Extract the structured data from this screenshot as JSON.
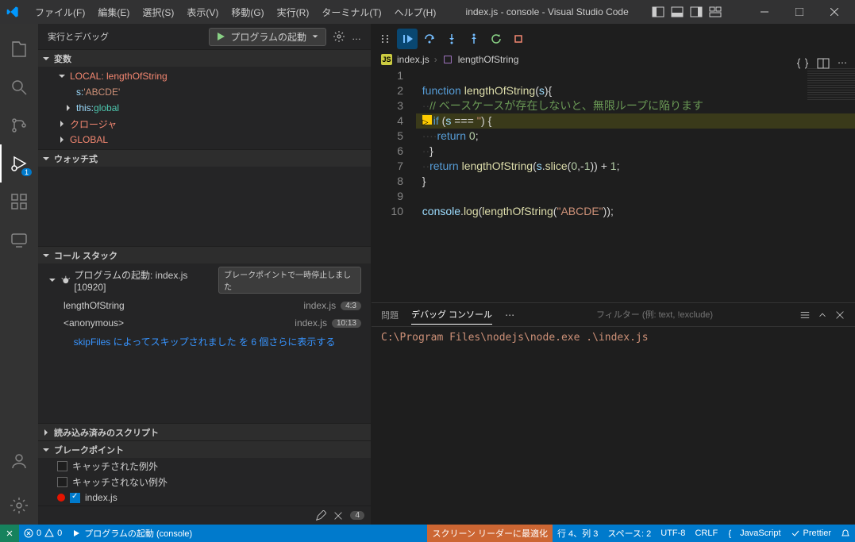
{
  "title": "index.js - console - Visual Studio Code",
  "menu": [
    "ファイル(F)",
    "編集(E)",
    "選択(S)",
    "表示(V)",
    "移動(G)",
    "実行(R)",
    "ターミナル(T)",
    "ヘルプ(H)"
  ],
  "activity_badge": "1",
  "sidebar": {
    "title": "実行とデバッグ",
    "launch_label": "プログラムの起動",
    "vars_header": "変数",
    "local_header": "LOCAL: lengthOfString",
    "var_s_key": "s: ",
    "var_s_val": "'ABCDE'",
    "var_this_key": "this: ",
    "var_this_val": "global",
    "closure_header": "クロージャ",
    "global_header": "GLOBAL",
    "watch_header": "ウォッチ式",
    "callstack_header": "コール スタック",
    "cs_program": "プログラムの起動: index.js [10920]",
    "cs_status": "ブレークポイントで一時停止しました",
    "frame1_name": "lengthOfString",
    "frame1_file": "index.js",
    "frame1_line": "4:3",
    "frame2_name": "<anonymous>",
    "frame2_file": "index.js",
    "frame2_line": "10:13",
    "skipfiles": "skipFiles によってスキップされました を 6 個さらに表示する",
    "loaded_scripts_header": "読み込み済みのスクリプト",
    "breakpoints_header": "ブレークポイント",
    "bp_caught": "キャッチされた例外",
    "bp_uncaught": "キャッチされない例外",
    "bp_file": "index.js",
    "bp_count": "4"
  },
  "breadcrumb": {
    "file": "index.js",
    "symbol": "lengthOfString"
  },
  "code": {
    "lines": [
      {
        "n": "1",
        "html": ""
      },
      {
        "n": "2",
        "html": "<span class='tok-kw'>function</span> <span class='tok-fn'>lengthOfString</span><span class='tok-pn'>(</span><span class='tok-var'>s</span><span class='tok-pn'>){</span>"
      },
      {
        "n": "3",
        "html": "<span class='tok-ws'>··</span><span class='tok-cm'>// ベースケースが存在しないと、無限ループに陥ります</span>"
      },
      {
        "n": "4",
        "html": "<span class='tok-ws'></span><span class='inline-ptr'>▷</span><span class='tok-kw'>if</span> <span class='tok-pn'>(</span><span class='tok-var'>s</span> <span class='tok-pn'>===</span> <span class='tok-str'>''</span><span class='tok-pn'>) {</span>",
        "hl": true,
        "bp": true
      },
      {
        "n": "5",
        "html": "<span class='tok-ws'>····</span><span class='tok-kw'>return</span> <span class='tok-num'>0</span><span class='tok-pn'>;</span>"
      },
      {
        "n": "6",
        "html": "<span class='tok-ws'>··</span><span class='tok-pn'>}</span>"
      },
      {
        "n": "7",
        "html": "<span class='tok-ws'>··</span><span class='tok-kw'>return</span> <span class='tok-fn'>lengthOfString</span><span class='tok-pn'>(</span><span class='tok-var'>s</span><span class='tok-pn'>.</span><span class='tok-fn'>slice</span><span class='tok-pn'>(</span><span class='tok-num'>0</span><span class='tok-pn'>,-</span><span class='tok-num'>1</span><span class='tok-pn'>)) + </span><span class='tok-num'>1</span><span class='tok-pn'>;</span>"
      },
      {
        "n": "8",
        "html": "<span class='tok-pn'>}</span>"
      },
      {
        "n": "9",
        "html": ""
      },
      {
        "n": "10",
        "html": "<span class='tok-var'>console</span><span class='tok-pn'>.</span><span class='tok-fn'>log</span><span class='tok-pn'>(</span><span class='tok-fn'>lengthOfString</span><span class='tok-pn'>(</span><span class='tok-str'>\"ABCDE\"</span><span class='tok-pn'>));</span>"
      }
    ]
  },
  "panel": {
    "tab_problems": "問題",
    "tab_debug": "デバッグ コンソール",
    "filter_placeholder": "フィルター (例: text, !exclude)",
    "output": "C:\\Program Files\\nodejs\\node.exe .\\index.js"
  },
  "status": {
    "errors": "0",
    "warnings": "0",
    "launch": "プログラムの起動 (console)",
    "screenreader": "スクリーン リーダーに最適化",
    "pos": "行 4、列 3",
    "spaces": "スペース: 2",
    "encoding": "UTF-8",
    "eol": "CRLF",
    "lang": "JavaScript",
    "prettier": "Prettier"
  }
}
